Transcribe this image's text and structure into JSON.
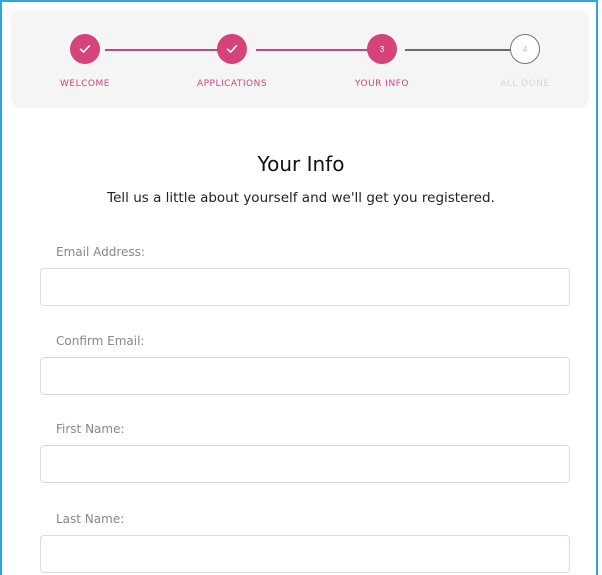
{
  "stepper": {
    "steps": [
      {
        "label": "WELCOME",
        "status": "done",
        "icon": "check-icon"
      },
      {
        "label": "APPLICATIONS",
        "status": "done",
        "icon": "check-icon"
      },
      {
        "label": "YOUR INFO",
        "status": "active",
        "number": "3"
      },
      {
        "label": "ALL DONE",
        "status": "todo",
        "number": "4"
      }
    ],
    "colors": {
      "accent": "#d6437b",
      "line_done": "#c8457a",
      "line_todo": "#6b6b6b",
      "label_todo": "#d6d6d6"
    }
  },
  "page": {
    "title": "Your Info",
    "subtitle": "Tell us a little about yourself and we'll get you registered."
  },
  "form": {
    "email": {
      "label": "Email Address:",
      "value": "",
      "placeholder": ""
    },
    "confirm_email": {
      "label": "Confirm Email:",
      "value": "",
      "placeholder": ""
    },
    "first_name": {
      "label": "First Name:",
      "value": "",
      "placeholder": ""
    },
    "last_name": {
      "label": "Last Name:",
      "value": "",
      "placeholder": ""
    }
  }
}
